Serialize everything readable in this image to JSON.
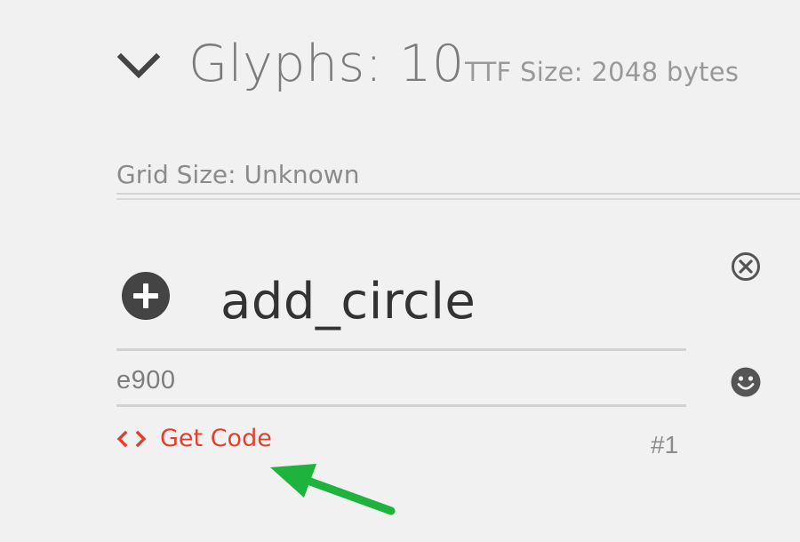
{
  "header": {
    "title": "Glyphs: 10",
    "ttf_size": "TTF Size: 2048 bytes",
    "collapse_icon": "chevron-down-icon"
  },
  "grid": {
    "label": "Grid Size: Unknown"
  },
  "glyph": {
    "preview_icon": "add-circle-icon",
    "name": "add_circle",
    "code_point": "e900",
    "get_code_label": "Get Code",
    "get_code_icon": "code-icon",
    "index": "#1",
    "remove_icon": "close-circle-icon",
    "emoji_icon": "smiley-icon"
  },
  "colors": {
    "background": "#f1f1f1",
    "link_accent": "#e0412f",
    "annotation_arrow": "#1db33c",
    "title_gray": "#7c7c7c",
    "glyph_dark": "#444444"
  }
}
